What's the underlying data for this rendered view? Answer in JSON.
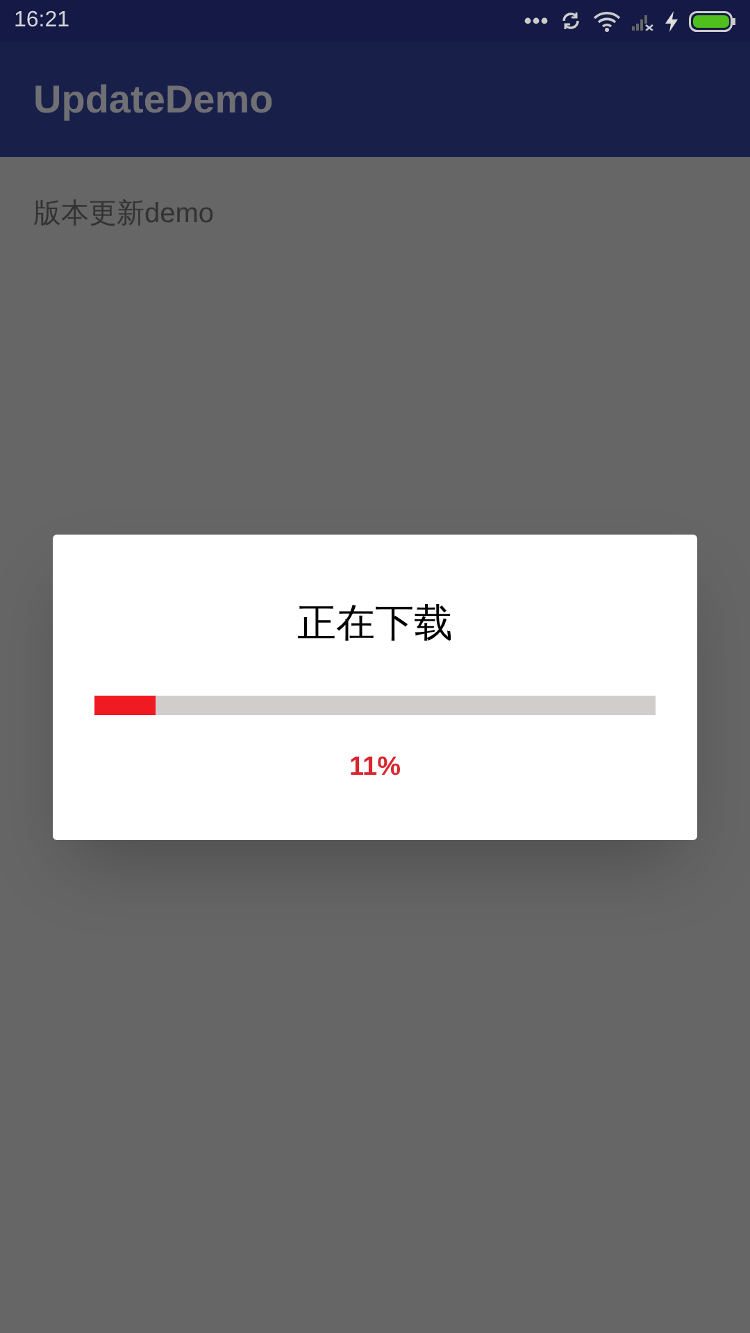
{
  "status_bar": {
    "time": "16:21"
  },
  "app_bar": {
    "title": "UpdateDemo"
  },
  "content": {
    "text": "版本更新demo"
  },
  "dialog": {
    "title": "正在下载",
    "progress": {
      "level": 0.11
    },
    "percent": "11%"
  }
}
